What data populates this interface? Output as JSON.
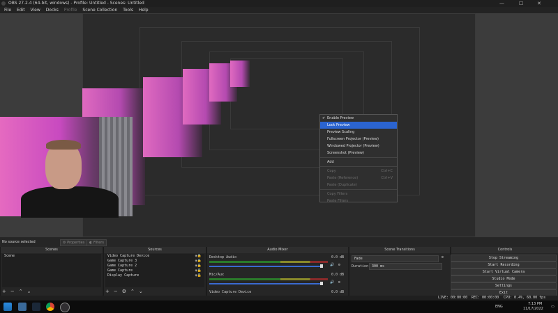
{
  "window": {
    "title": "OBS 27.2.4 (64-bit, windows) - Profile: Untitled - Scenes: Untitled",
    "min": "—",
    "max": "☐",
    "close": "✕"
  },
  "menu": [
    "File",
    "Edit",
    "View",
    "Docks",
    "Profile",
    "Scene Collection",
    "Tools",
    "Help"
  ],
  "context_menu": {
    "items": [
      {
        "label": "Enable Preview",
        "checked": true
      },
      {
        "label": "Lock Preview",
        "highlighted": true
      },
      {
        "label": "Preview Scaling",
        "submenu": true
      },
      {
        "label": "Fullscreen Projector (Preview)",
        "submenu": true
      },
      {
        "label": "Windowed Projector (Preview)"
      },
      {
        "label": "Screenshot (Preview)"
      },
      {
        "label": "Add",
        "submenu": true
      },
      {
        "label": "Copy",
        "disabled": true,
        "shortcut": "Ctrl+C"
      },
      {
        "label": "Paste (Reference)",
        "disabled": true,
        "shortcut": "Ctrl+V"
      },
      {
        "label": "Paste (Duplicate)",
        "disabled": true
      },
      {
        "label": "Copy Filters",
        "disabled": true
      },
      {
        "label": "Paste Filters",
        "disabled": true
      }
    ]
  },
  "status_row": {
    "no_source": "No source selected",
    "properties": "Properties",
    "filters": "Filters"
  },
  "docks": {
    "scenes": {
      "title": "Scenes",
      "items": [
        "Scene"
      ]
    },
    "sources": {
      "title": "Sources",
      "items": [
        "Video Capture Device",
        "Game Capture 3",
        "Game Capture 2",
        "Game Capture",
        "Display Capture"
      ]
    },
    "mixer": {
      "title": "Audio Mixer",
      "channels": [
        {
          "name": "Desktop Audio",
          "db": "0.0 dB"
        },
        {
          "name": "Mic/Aux",
          "db": "0.0 dB"
        },
        {
          "name": "Video Capture Device",
          "db": "0.0 dB"
        }
      ]
    },
    "transitions": {
      "title": "Scene Transitions",
      "type": "Fade",
      "duration_label": "Duration",
      "duration": "300 ms"
    },
    "controls": {
      "title": "Controls",
      "buttons": [
        "Stop Streaming",
        "Start Recording",
        "Start Virtual Camera",
        "Studio Mode",
        "Settings",
        "Exit"
      ]
    }
  },
  "stats": {
    "live": "LIVE: 00:00:00",
    "rec": "REC: 00:00:00",
    "cpu": "CPU: 0.4%, 60.00 fps"
  },
  "taskbar": {
    "lang": "ENG",
    "time": "7:13 PM",
    "date": "11/17/2022"
  },
  "accent": "#2b64d0"
}
